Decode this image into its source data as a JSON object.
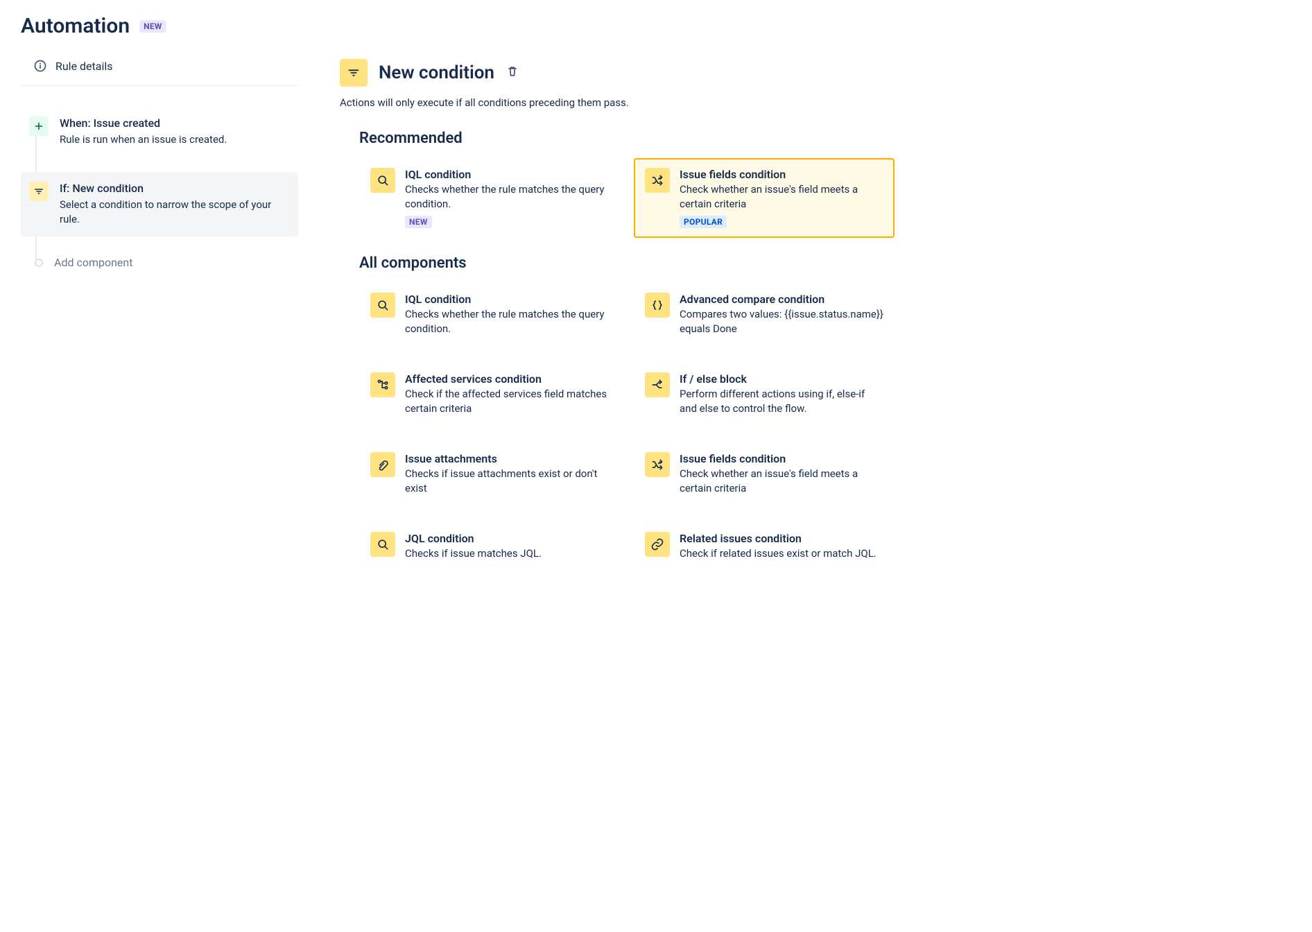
{
  "header": {
    "title": "Automation",
    "badge": "NEW"
  },
  "sidebar": {
    "rule_details": "Rule details",
    "steps": [
      {
        "title": "When: Issue created",
        "desc": "Rule is run when an issue is created.",
        "icon": "plus",
        "selected": false
      },
      {
        "title": "If: New condition",
        "desc": "Select a condition to narrow the scope of your rule.",
        "icon": "filter",
        "selected": true
      }
    ],
    "add_component": "Add component"
  },
  "main": {
    "title": "New condition",
    "subtitle": "Actions will only execute if all conditions preceding them pass.",
    "sections": {
      "recommended": {
        "title": "Recommended",
        "cards": [
          {
            "title": "IQL condition",
            "desc": "Checks whether the rule matches the query condition.",
            "badge": "NEW",
            "badge_type": "new",
            "icon": "search",
            "highlighted": false
          },
          {
            "title": "Issue fields condition",
            "desc": "Check whether an issue's field meets a certain criteria",
            "badge": "POPULAR",
            "badge_type": "popular",
            "icon": "shuffle",
            "highlighted": true
          }
        ]
      },
      "all": {
        "title": "All components",
        "cards": [
          {
            "title": "IQL condition",
            "desc": "Checks whether the rule matches the query condition.",
            "icon": "search"
          },
          {
            "title": "Advanced compare condition",
            "desc": "Compares two values: {{issue.status.name}} equals Done",
            "icon": "braces"
          },
          {
            "title": "Affected services condition",
            "desc": "Check if the affected services field matches certain criteria",
            "icon": "network"
          },
          {
            "title": "If / else block",
            "desc": "Perform different actions using if, else-if and else to control the flow.",
            "icon": "branch"
          },
          {
            "title": "Issue attachments",
            "desc": "Checks if issue attachments exist or don't exist",
            "icon": "attachment"
          },
          {
            "title": "Issue fields condition",
            "desc": "Check whether an issue's field meets a certain criteria",
            "icon": "shuffle"
          },
          {
            "title": "JQL condition",
            "desc": "Checks if issue matches JQL.",
            "icon": "search"
          },
          {
            "title": "Related issues condition",
            "desc": "Check if related issues exist or match JQL.",
            "icon": "link"
          }
        ]
      }
    }
  }
}
